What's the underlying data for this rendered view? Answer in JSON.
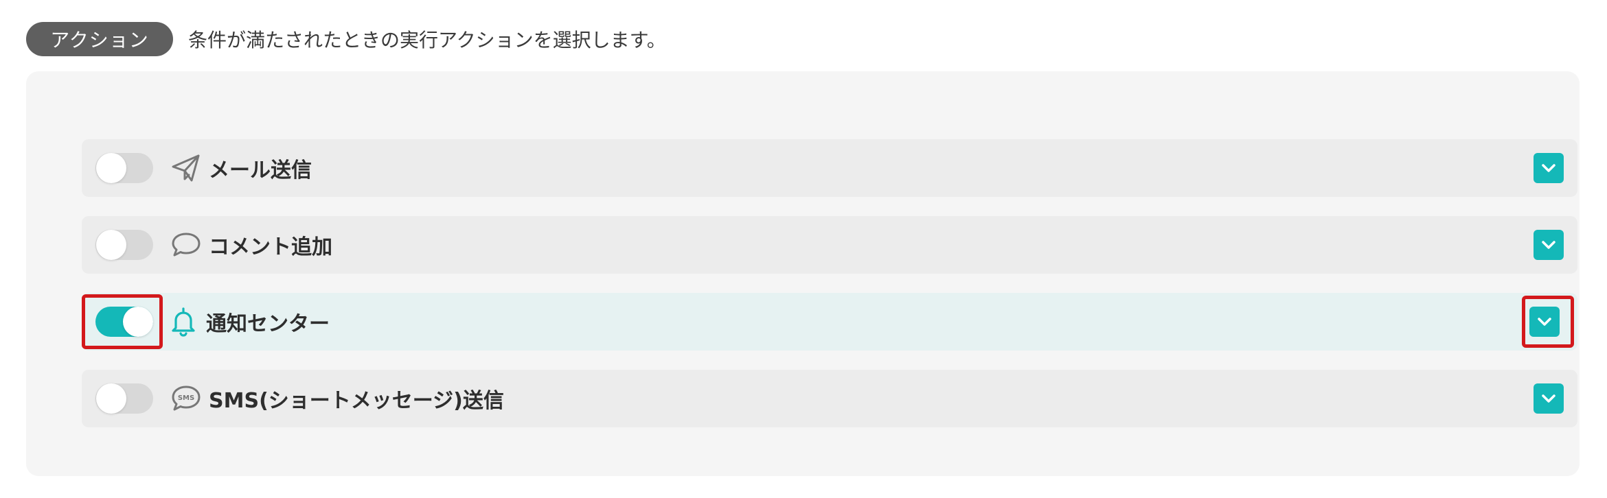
{
  "header": {
    "badge_label": "アクション",
    "description": "条件が満たされたときの実行アクションを選択します。"
  },
  "actions": [
    {
      "label": "メール送信",
      "icon": "paper-plane-icon",
      "enabled": false,
      "highlighted": false
    },
    {
      "label": "コメント追加",
      "icon": "speech-bubble-icon",
      "enabled": false,
      "highlighted": false
    },
    {
      "label": "通知センター",
      "icon": "bell-icon",
      "enabled": true,
      "highlighted": true
    },
    {
      "label": "SMS(ショートメッセージ)送信",
      "icon": "sms-bubble-icon",
      "enabled": false,
      "highlighted": false
    }
  ],
  "colors": {
    "accent": "#14b8b8",
    "highlight": "#d3191c",
    "badge": "#5f5f5f"
  }
}
